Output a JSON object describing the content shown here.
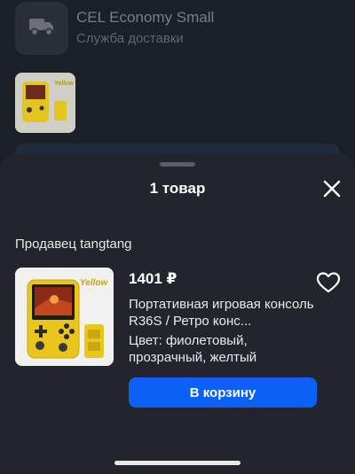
{
  "background": {
    "delivery_title": "CEL Economy Small",
    "delivery_subtitle": "Служба доставки",
    "delivery_icon": "truck-icon"
  },
  "sheet": {
    "title": "1 товар",
    "close_icon": "close-icon",
    "seller_label": "Продавец tangtang",
    "product": {
      "price": "1401 ₽",
      "name": "Портативная игровая консоль R36S / Ретро конс...",
      "color": "Цвет: фиолетовый, прозрачный, желтый",
      "image_label": "Yellow",
      "favorite_icon": "heart-icon"
    },
    "cart_button_label": "В корзину"
  },
  "colors": {
    "accent": "#0a62f5",
    "sheet_bg": "#22252b",
    "page_bg": "#1b1f26"
  }
}
